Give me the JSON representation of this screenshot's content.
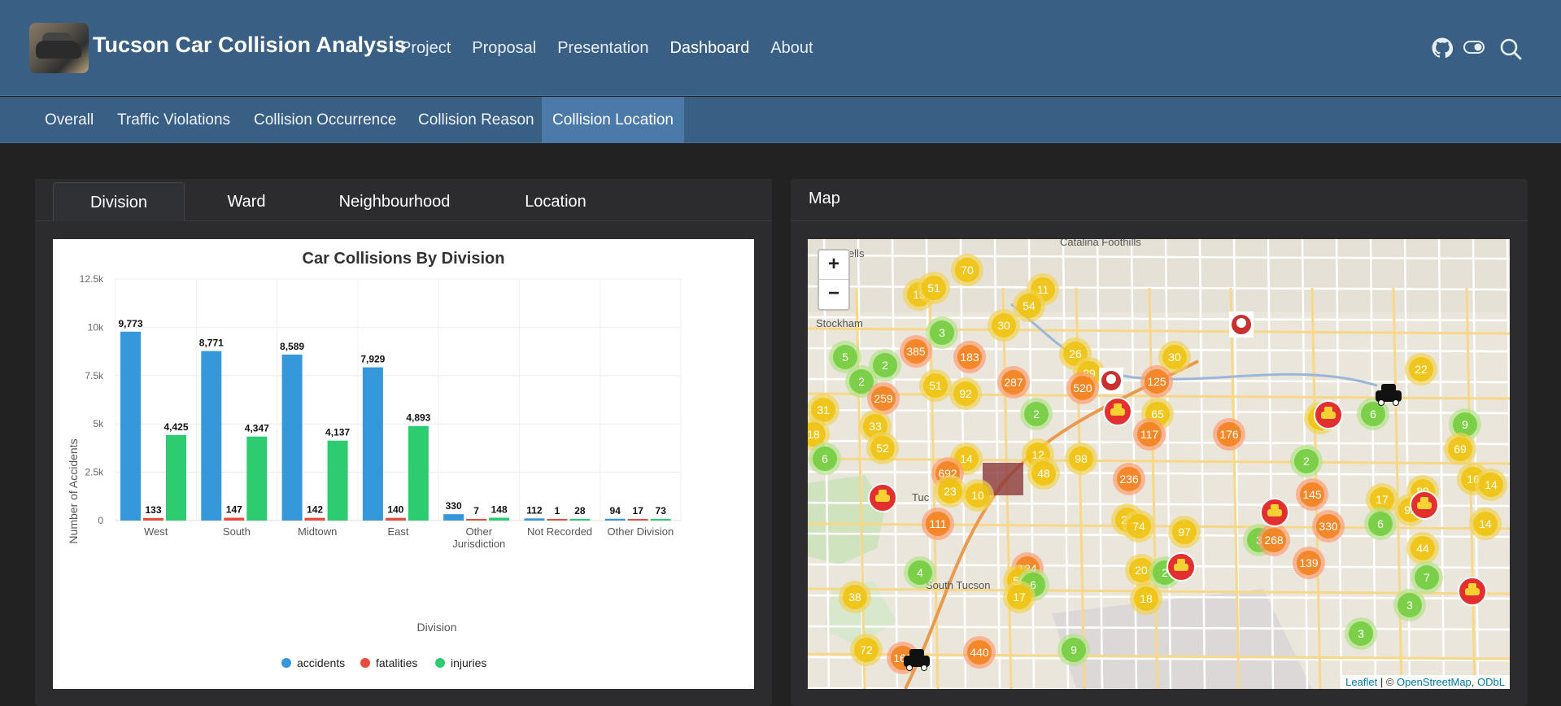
{
  "app": {
    "brand": "Tucson Car Collision Analysis",
    "nav": [
      "Project",
      "Proposal",
      "Presentation",
      "Dashboard",
      "About"
    ],
    "active_nav": "Dashboard",
    "icons": [
      "github-icon",
      "theme-toggle-icon",
      "search-icon"
    ]
  },
  "subnav": {
    "items": [
      "Overall",
      "Traffic Violations",
      "Collision Occurrence",
      "Collision Reason",
      "Collision Location"
    ],
    "active": "Collision Location"
  },
  "left_panel": {
    "tabs": [
      "Division",
      "Ward",
      "Neighbourhood",
      "Location"
    ],
    "active_tab": "Division"
  },
  "chart_data": {
    "type": "bar",
    "title": "Car Collisions By Division",
    "xlabel": "Division",
    "ylabel": "Number of Accidents",
    "categories": [
      "West",
      "South",
      "Midtown",
      "East",
      "Other Jurisdiction",
      "Not Recorded",
      "Other Division"
    ],
    "series": [
      {
        "name": "accidents",
        "color": "#3498db",
        "values": [
          9773,
          8771,
          8589,
          7929,
          330,
          112,
          94
        ],
        "labels": [
          "9,773",
          "8,771",
          "8,589",
          "7,929",
          "330",
          "112",
          "94"
        ]
      },
      {
        "name": "fatalities",
        "color": "#e74c3c",
        "values": [
          133,
          147,
          142,
          140,
          7,
          1,
          17
        ],
        "labels": [
          "133",
          "147",
          "142",
          "140",
          "7",
          "1",
          "17"
        ]
      },
      {
        "name": "injuries",
        "color": "#2ecc71",
        "values": [
          4425,
          4347,
          4137,
          4893,
          148,
          28,
          73
        ],
        "labels": [
          "4,425",
          "4,347",
          "4,137",
          "4,893",
          "148",
          "28",
          "73"
        ]
      }
    ],
    "ylim": [
      0,
      12500
    ],
    "yticks": [
      0,
      2500,
      5000,
      7500,
      10000,
      12500
    ],
    "ytick_labels": [
      "0",
      "2.5k",
      "5k",
      "7.5k",
      "10k",
      "12.5k"
    ],
    "grid": true,
    "legend_position": "bottom"
  },
  "map": {
    "title": "Map",
    "zoom_in": "+",
    "zoom_out": "−",
    "attribution": {
      "leaflet": "Leaflet",
      "sep": " | © ",
      "osm": "OpenStreetMap",
      "comma": ", ",
      "odbl": "ODbL"
    },
    "place_labels": [
      "Catalina Foothills",
      "Stockham",
      "Tuc",
      "South Tucson",
      "Vells"
    ],
    "clusters": [
      "70",
      "19",
      "51",
      "11",
      "54",
      "3",
      "30",
      "385",
      "183",
      "5",
      "2",
      "2",
      "30",
      "26",
      "89",
      "125",
      "287",
      "520",
      "51",
      "92",
      "259",
      "31",
      "33",
      "2",
      "65",
      "117",
      "176",
      "18",
      "52",
      "6",
      "14",
      "692",
      "12",
      "48",
      "98",
      "236",
      "23",
      "10",
      "111",
      "4",
      "124",
      "50",
      "6",
      "17",
      "38",
      "72",
      "162",
      "21",
      "74",
      "97",
      "20",
      "2",
      "18",
      "9",
      "440",
      "3",
      "268",
      "139",
      "330",
      "89",
      "17",
      "2",
      "145",
      "6",
      "44",
      "7",
      "17",
      "9",
      "22",
      "69",
      "16",
      "14",
      "92",
      "14",
      "3",
      "3",
      "6"
    ]
  }
}
